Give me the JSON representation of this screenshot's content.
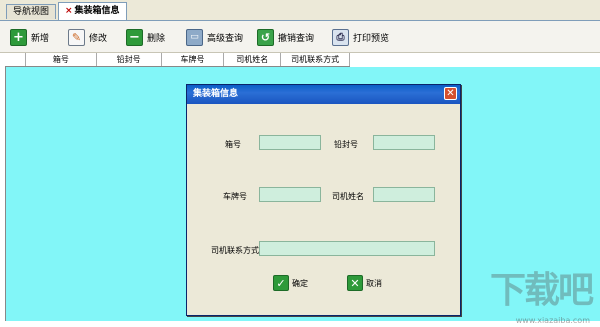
{
  "tabs": [
    {
      "label": "导航视图",
      "active": false
    },
    {
      "label": "集装箱信息",
      "active": true,
      "close_glyph": "×"
    }
  ],
  "toolbar": {
    "add": {
      "label": "新增",
      "icon": "plus-icon"
    },
    "edit": {
      "label": "修改",
      "icon": "pencil-icon"
    },
    "delete": {
      "label": "删除",
      "icon": "minus-icon"
    },
    "advanced_query": {
      "label": "高级查询",
      "icon": "monitor-icon"
    },
    "undo_query": {
      "label": "撤销查询",
      "icon": "undo-icon"
    },
    "print_preview": {
      "label": "打印预览",
      "icon": "print-preview-icon"
    }
  },
  "grid": {
    "columns": [
      "箱号",
      "铅封号",
      "车牌号",
      "司机姓名",
      "司机联系方式"
    ],
    "background": "#82f6f8"
  },
  "dialog": {
    "title": "集装箱信息",
    "close_glyph": "✕",
    "fields": {
      "box_no": {
        "label": "箱号",
        "value": ""
      },
      "seal_no": {
        "label": "铅封号",
        "value": ""
      },
      "plate_no": {
        "label": "车牌号",
        "value": ""
      },
      "driver_name": {
        "label": "司机姓名",
        "value": ""
      },
      "driver_contact": {
        "label": "司机联系方式",
        "value": ""
      }
    },
    "ok_label": "确定",
    "cancel_label": "取消"
  },
  "watermark": {
    "text": "下载吧",
    "url": "www.xiazaiba.com"
  }
}
